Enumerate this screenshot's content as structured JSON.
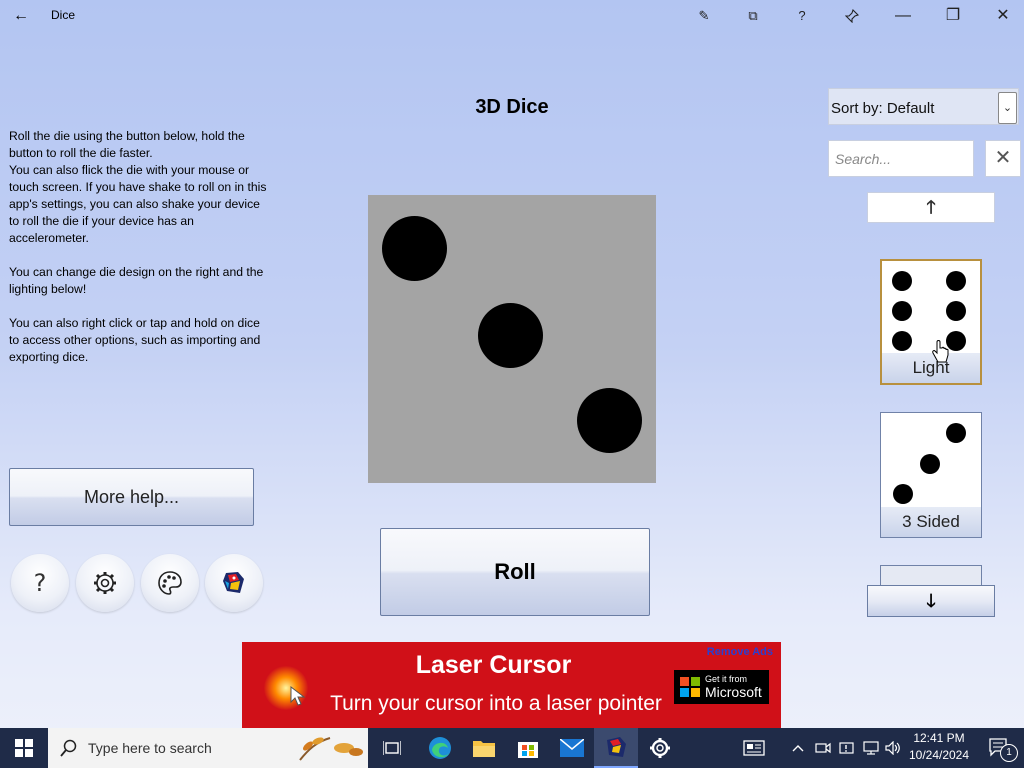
{
  "window": {
    "back_glyph": "←",
    "title": "Dice",
    "edit_glyph": "✎",
    "overlay_glyph": "⧉",
    "help_glyph": "?",
    "pin_glyph": "📌",
    "minimize_glyph": "—",
    "restore_glyph": "❐",
    "close_glyph": "✕"
  },
  "instructions": {
    "p1": "Roll the die using the button below, hold the button to roll the die faster.\nYou can also flick the die with your mouse or touch screen. If you have shake to roll on in this app's settings, you can also shake your device to roll the die if your device has an accelerometer.",
    "p2": "You can change die design on the right and the lighting  below!",
    "p3": "You can also right click or tap and hold on dice to access other options, such as importing and exporting dice."
  },
  "more_help_label": "More help...",
  "round_buttons": {
    "help_glyph": "?"
  },
  "die": {
    "title": "3D Dice",
    "face_value": 3,
    "face_color": "#a4a4a4"
  },
  "roll_label": "Roll",
  "sort": {
    "label": "Sort by: Default",
    "arrow_glyph": "⌄"
  },
  "search": {
    "placeholder": "Search...",
    "clear_glyph": "✕"
  },
  "scroll": {
    "up_glyph": "🡑",
    "down_glyph": "🡓"
  },
  "die_cards": [
    {
      "label": "Light",
      "pips": 6,
      "selected": true
    },
    {
      "label": "3 Sided",
      "pips": 3,
      "selected": false
    }
  ],
  "ad": {
    "title": "Laser Cursor",
    "subtitle": "Turn your cursor into a laser pointer",
    "remove_label": "Remove Ads",
    "store_small": "Get it from",
    "store_big": "Microsoft"
  },
  "taskbar": {
    "search_placeholder": "Type here to search",
    "time": "12:41 PM",
    "date": "10/24/2024",
    "notification_count": "1",
    "accent": "#1f2b48"
  }
}
